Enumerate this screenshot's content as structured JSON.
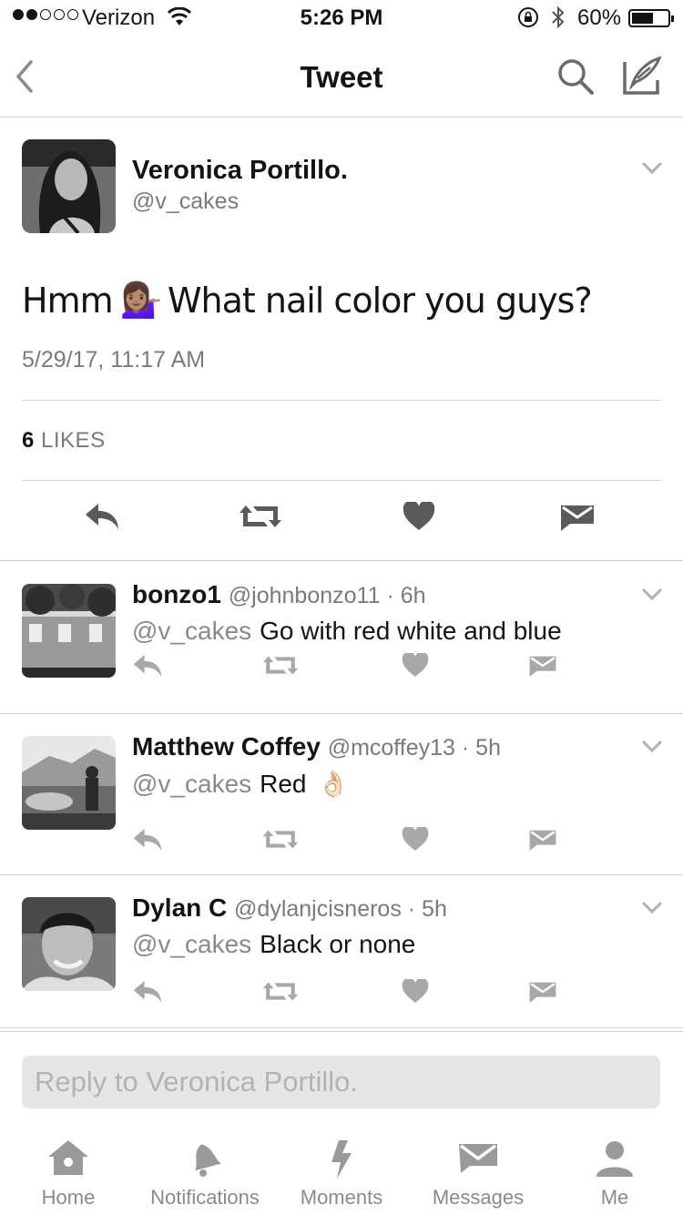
{
  "status_bar": {
    "carrier": "Verizon",
    "time": "5:26 PM",
    "battery_percent": "60%",
    "battery_level": 0.6,
    "signal_bars_filled": 2,
    "signal_bars_total": 5
  },
  "nav": {
    "title": "Tweet",
    "icons": [
      "back-chevron-icon",
      "search-icon",
      "compose-icon"
    ]
  },
  "tweet": {
    "author_name": "Veronica Portillo.",
    "author_handle": "@v_cakes",
    "text_before": "Hmm",
    "text_emoji": "💁🏽‍♀️",
    "text_after": "What nail color you guys?",
    "date": "5/29/17, 11:17 AM",
    "likes_count": "6",
    "likes_label": "LIKES"
  },
  "replies": [
    {
      "name": "bonzo1",
      "meta": "@johnbonzo11 · 6h",
      "mention": "@v_cakes",
      "text": "Go with red white and blue",
      "emoji": ""
    },
    {
      "name": "Matthew Coffey",
      "meta": "@mcoffey13 · 5h",
      "mention": "@v_cakes",
      "text": "Red",
      "emoji": "👌🏻"
    },
    {
      "name": "Dylan C",
      "meta": "@dylanjcisneros · 5h",
      "mention": "@v_cakes",
      "text": "Black or none",
      "emoji": ""
    }
  ],
  "reply_bar": {
    "placeholder": "Reply to Veronica Portillo."
  },
  "tabs": [
    {
      "label": "Home",
      "icon": "home-icon"
    },
    {
      "label": "Notifications",
      "icon": "bell-icon"
    },
    {
      "label": "Moments",
      "icon": "lightning-icon"
    },
    {
      "label": "Messages",
      "icon": "envelope-icon"
    },
    {
      "label": "Me",
      "icon": "person-icon"
    }
  ],
  "colors": {
    "text": "#141414",
    "secondary": "#7a7a7a",
    "icon_dark": "#5a5a5a",
    "icon_light": "#a8a8a8",
    "divider": "#cfcfcf"
  }
}
